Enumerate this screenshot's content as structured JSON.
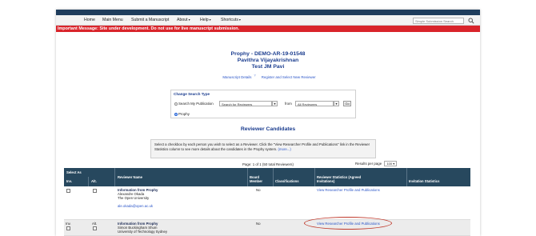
{
  "nav": {
    "items": [
      "Home",
      "Main Menu",
      "Submit a Manuscript",
      "About",
      "Help",
      "Shortcuts"
    ],
    "search_placeholder": "Simple Submission Search"
  },
  "alert": "Important Message: Site under development. Do not use for live manuscript submission.",
  "header": {
    "line1": "Prophy - DEMO-AR-19-01548",
    "line2": "Pavithra Vijayakrishnan",
    "line3": "Test JM Pavi",
    "link_details": "Manuscript Details",
    "link_register": "Register and Select New Reviewer"
  },
  "search_panel": {
    "title": "Change Search Type",
    "option_publication": "Search My Publication",
    "option_prophy": "Prophy",
    "selected": "Prophy",
    "field_value": "Search for Reviewers",
    "from_label": "from",
    "from_value": "All Reviewers",
    "go_label": "Go"
  },
  "section_title": "Reviewer Candidates",
  "info": {
    "text": "Select a checkbox by each person you wish to select as a Reviewer. Click the \"View Researcher Profile and Publications\" link in the Reviewer Statistics column to see more details about the candidates in the Prophy system.",
    "more": "(more...)"
  },
  "pager": {
    "text": "Page: 1 of 1 (50 total Reviewers)",
    "per_page_label": "Results per page",
    "per_page_value": "100"
  },
  "table": {
    "headers": {
      "select_as": "Select As",
      "inv": "Inv.",
      "alt": "Alt.",
      "reviewer_name": "Reviewer Name",
      "board_member": "Board Member",
      "classifications": "Classifications",
      "reviewer_statistics": "Reviewer Statistics (Agreed Invitations)",
      "invitation_statistics": "Invitation Statistics"
    },
    "rows": [
      {
        "info_label": "Information from Prophy",
        "name": "Alexandre Okada",
        "affiliation": "The Open University",
        "email": "ale.okada@open.ac.uk",
        "board_member": "No",
        "stats_link": "View Researcher Profile and Publications"
      },
      {
        "inv_label": "Inv.",
        "alt_label": "Alt.",
        "info_label": "Information from Prophy",
        "name": "Simon Buckingham Shum",
        "affiliation": "University of Technology Sydney",
        "board_member": "No",
        "stats_link": "View Researcher Profile and Publications"
      }
    ]
  },
  "colors": {
    "alert": "#d9242b",
    "header_bar": "#1f3d5c",
    "table_header": "#27485e",
    "title_blue": "#1b3d8f",
    "link": "#2a55c8",
    "highlight_ellipse": "#c0392b"
  },
  "icons": [
    "search-icon",
    "chevron-down-icon",
    "help-icon"
  ]
}
